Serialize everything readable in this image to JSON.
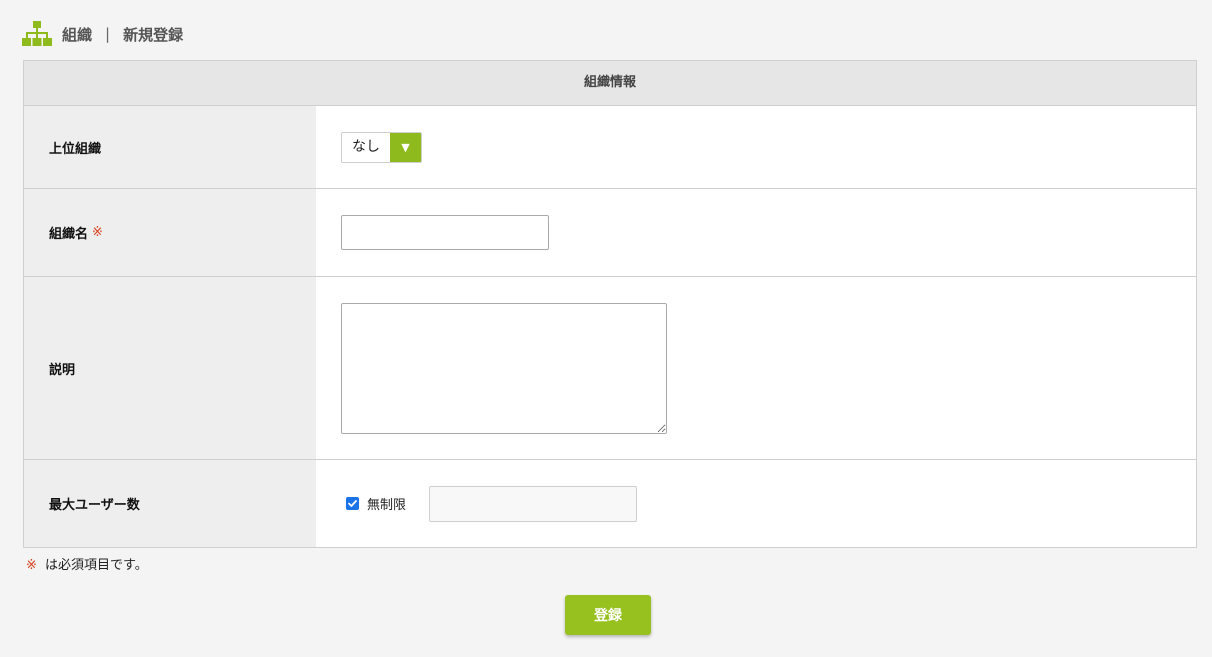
{
  "header": {
    "section": "組織",
    "separator": "|",
    "page_title": "新規登録",
    "icon": "org-chart-icon"
  },
  "form": {
    "section_title": "組織情報",
    "required_mark": "※",
    "parent_org": {
      "label": "上位組織",
      "selected": "なし",
      "arrow": "▼"
    },
    "org_name": {
      "label": "組織名",
      "value": ""
    },
    "description": {
      "label": "説明",
      "value": ""
    },
    "max_users": {
      "label": "最大ユーザー数",
      "unlimited_label": "無制限",
      "unlimited_checked": true,
      "value": ""
    }
  },
  "note": {
    "mark": "※",
    "text": "は必須項目です。"
  },
  "submit_label": "登録",
  "colors": {
    "accent": "#96c11f",
    "required": "#d9411e",
    "checkbox": "#1a73e8"
  }
}
